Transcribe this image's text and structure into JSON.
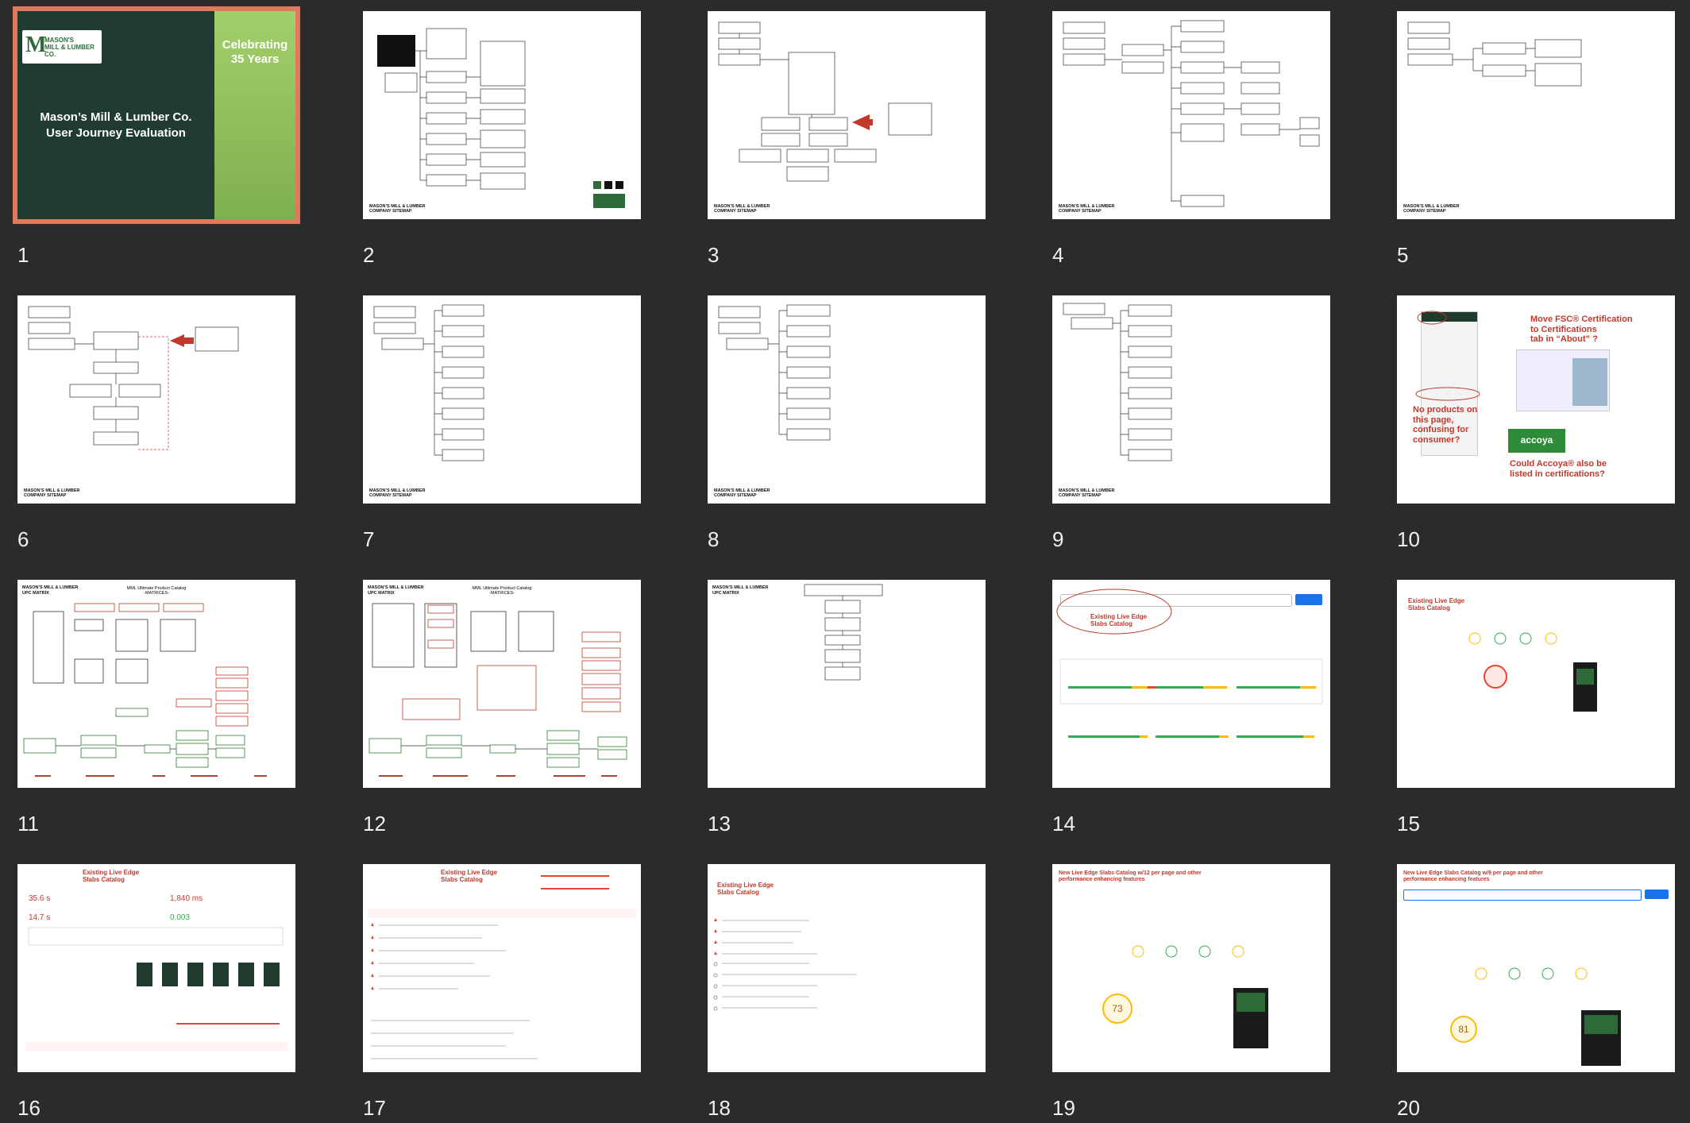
{
  "slides": [
    {
      "n": "1",
      "title_left": "Mason’s Mill & Lumber Co.\nUser Journey Evaluation",
      "celebrate": "Celebrating\n35 Years",
      "logo": "MASON'S\nMILL & LUMBER CO."
    },
    {
      "n": "2",
      "footer": "MASON’S MILL & LUMBER\nCOMPANY SITEMAP"
    },
    {
      "n": "3",
      "footer": "MASON’S MILL & LUMBER\nCOMPANY SITEMAP"
    },
    {
      "n": "4",
      "footer": "MASON’S MILL & LUMBER\nCOMPANY SITEMAP"
    },
    {
      "n": "5",
      "footer": "MASON’S MILL & LUMBER\nCOMPANY SITEMAP"
    },
    {
      "n": "6",
      "footer": "MASON’S MILL & LUMBER\nCOMPANY SITEMAP"
    },
    {
      "n": "7",
      "footer": "MASON’S MILL & LUMBER\nCOMPANY SITEMAP"
    },
    {
      "n": "8",
      "footer": "MASON’S MILL & LUMBER\nCOMPANY SITEMAP"
    },
    {
      "n": "9",
      "footer": "MASON’S MILL & LUMBER\nCOMPANY SITEMAP"
    },
    {
      "n": "10",
      "note1": "Move FSC® Certification\nto Certifications\ntab in “About” ?",
      "note2": "No products on\nthis page,\nconfusing for\nconsumer?",
      "note3": "Could Accoya® also be\nlisted in certifications?",
      "badge": "accoya"
    },
    {
      "n": "11",
      "head": "MASON’S MILL & LUMBER\nUPC MATRIX",
      "center": "MML Ultimate Product Catalog\n-MATRICES-"
    },
    {
      "n": "12",
      "head": "MASON’S MILL & LUMBER\nUPC MATRIX",
      "center": "MML Ultimate Product Catalog\n-MATRICES-"
    },
    {
      "n": "13",
      "head": "MASON’S MILL & LUMBER\nUPC MATRIX"
    },
    {
      "n": "14",
      "label": "Existing Live Edge\nSlabs Catalog"
    },
    {
      "n": "15",
      "label": "Existing Live Edge\nSlabs Catalog"
    },
    {
      "n": "16",
      "label": "Existing Live Edge\nSlabs Catalog",
      "m1": "35.6 s",
      "m2": "1,840 ms",
      "m3": "14.7 s",
      "m4": "0.003"
    },
    {
      "n": "17",
      "label": "Existing Live Edge\nSlabs Catalog"
    },
    {
      "n": "18",
      "label": "Existing Live Edge\nSlabs Catalog"
    },
    {
      "n": "19",
      "label": "New Live Edge Slabs Catalog w/12 per page and other\nperformance enhancing features",
      "score": "73"
    },
    {
      "n": "20",
      "label": "New Live Edge Slabs Catalog w/9 per page and other\nperformance enhancing features",
      "score": "81"
    }
  ],
  "colors": {
    "bg": "#2b2b2b",
    "selected": "#e07a5f",
    "accent_red": "#c0392b",
    "green": "#2e7d32"
  }
}
